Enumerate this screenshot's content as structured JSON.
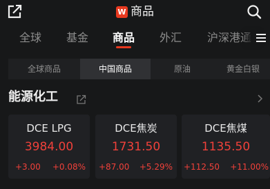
{
  "header": {
    "title": "商品",
    "app_badge": "W",
    "left_icon": "external-link-icon",
    "right_icon": "search-icon"
  },
  "tabs": [
    {
      "label": "全球"
    },
    {
      "label": "基金"
    },
    {
      "label": "商品",
      "active": true
    },
    {
      "label": "外汇"
    },
    {
      "label": "沪深港通"
    }
  ],
  "subtabs": [
    {
      "label": "全球商品"
    },
    {
      "label": "中国商品",
      "active": true
    },
    {
      "label": "原油"
    },
    {
      "label": "黄金白银"
    }
  ],
  "section": {
    "title": "能源化工"
  },
  "cards": [
    {
      "name": "DCE LPG",
      "price": "3984.00",
      "change": "+3.00",
      "pct": "+0.08%"
    },
    {
      "name": "DCE焦炭",
      "price": "1731.50",
      "change": "+87.00",
      "pct": "+5.29%"
    },
    {
      "name": "DCE焦煤",
      "price": "1135.50",
      "change": "+112.50",
      "pct": "+11.00%"
    }
  ],
  "colors": {
    "accent": "#e8391f",
    "up": "#f0413a",
    "background": "#171819"
  }
}
